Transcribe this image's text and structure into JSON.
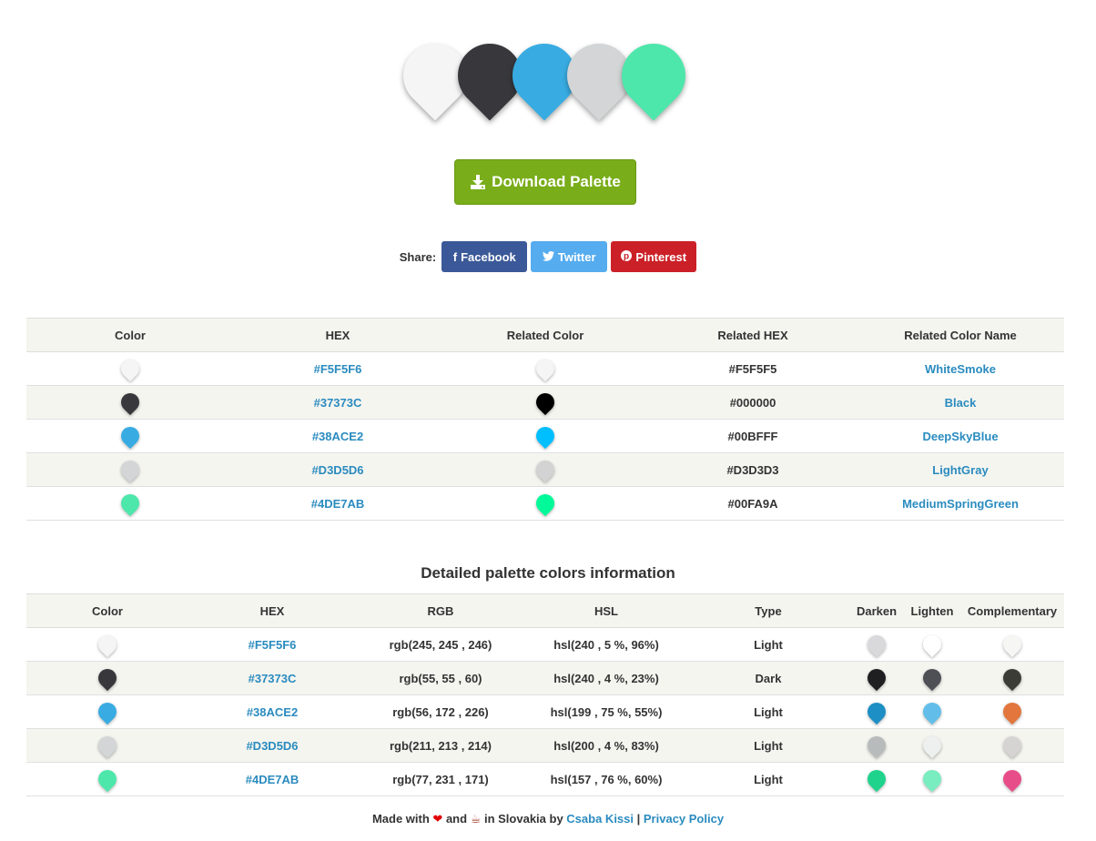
{
  "hero_colors": [
    "#F5F5F6",
    "#37373C",
    "#38ACE2",
    "#D3D5D6",
    "#4DE7AB"
  ],
  "download_label": "Download Palette",
  "share": {
    "label": "Share:",
    "facebook": "Facebook",
    "twitter": "Twitter",
    "pinterest": "Pinterest",
    "colors": {
      "facebook": "#3b5998",
      "twitter": "#55acee",
      "pinterest": "#cb2027"
    }
  },
  "related_table": {
    "headers": [
      "Color",
      "HEX",
      "Related Color",
      "Related HEX",
      "Related Color Name"
    ],
    "rows": [
      {
        "hex": "#F5F5F6",
        "related_hex": "#F5F5F5",
        "name": "WhiteSmoke"
      },
      {
        "hex": "#37373C",
        "related_hex": "#000000",
        "name": "Black"
      },
      {
        "hex": "#38ACE2",
        "related_hex": "#00BFFF",
        "name": "DeepSkyBlue"
      },
      {
        "hex": "#D3D5D6",
        "related_hex": "#D3D3D3",
        "name": "LightGray"
      },
      {
        "hex": "#4DE7AB",
        "related_hex": "#00FA9A",
        "name": "MediumSpringGreen"
      }
    ]
  },
  "detail_title": "Detailed palette colors information",
  "detail_table": {
    "headers": [
      "Color",
      "HEX",
      "RGB",
      "HSL",
      "Type",
      "Darken",
      "Lighten",
      "Complementary"
    ],
    "rows": [
      {
        "hex": "#F5F5F6",
        "rgb": "rgb(245, 245 , 246)",
        "hsl": "hsl(240 , 5 %, 96%)",
        "type": "Light",
        "darken": "#D9D9DC",
        "lighten": "#FFFFFF",
        "complementary": "#F6F6F5"
      },
      {
        "hex": "#37373C",
        "rgb": "rgb(55, 55 , 60)",
        "hsl": "hsl(240 , 4 %, 23%)",
        "type": "Dark",
        "darken": "#1F1F22",
        "lighten": "#4F4F56",
        "complementary": "#3C3C37"
      },
      {
        "hex": "#38ACE2",
        "rgb": "rgb(56, 172 , 226)",
        "hsl": "hsl(199 , 75 %, 55%)",
        "type": "Light",
        "darken": "#1E8FC4",
        "lighten": "#62BEE9",
        "complementary": "#E2763C"
      },
      {
        "hex": "#D3D5D6",
        "rgb": "rgb(211, 213 , 214)",
        "hsl": "hsl(200 , 4 %, 83%)",
        "type": "Light",
        "darken": "#B8BBBC",
        "lighten": "#EEEFEF",
        "complementary": "#D6D4D3"
      },
      {
        "hex": "#4DE7AB",
        "rgb": "rgb(77, 231 , 171)",
        "hsl": "hsl(157 , 76 %, 60%)",
        "type": "Light",
        "darken": "#1FD38D",
        "lighten": "#79EDC0",
        "complementary": "#E74D89"
      }
    ]
  },
  "footer": {
    "made_with": "Made with",
    "and": "and",
    "in_slovakia": "in Slovakia by",
    "author": "Csaba Kissi",
    "separator": "|",
    "privacy": "Privacy Policy"
  }
}
